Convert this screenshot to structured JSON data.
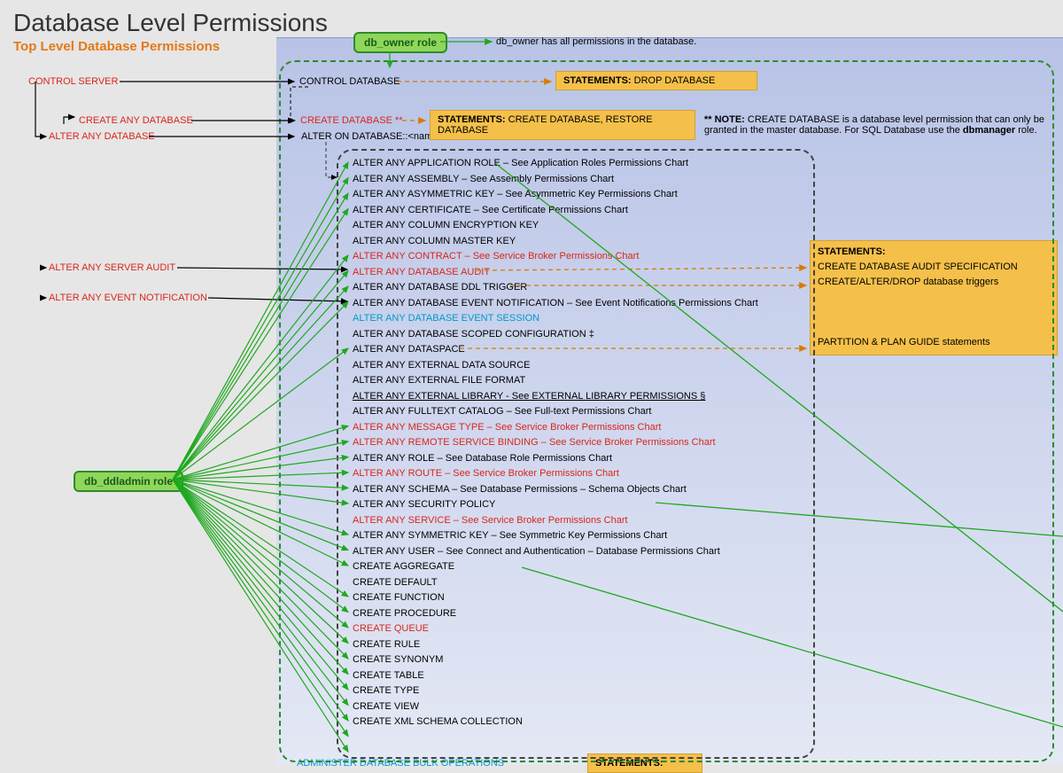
{
  "title": "Database Level Permissions",
  "subtitle": "Top Level Database Permissions",
  "roles": {
    "db_owner": "db_owner role",
    "db_owner_note": "db_owner has all permissions in the database.",
    "db_ddladmin": "db_ddladmin role"
  },
  "left": {
    "control_server": "CONTROL SERVER",
    "create_any_db": "CREATE ANY DATABASE",
    "alter_any_db": "ALTER ANY DATABASE",
    "alter_server_audit": "ALTER ANY SERVER AUDIT",
    "alter_event_notif": "ALTER ANY EVENT NOTIFICATION"
  },
  "center": {
    "control_db": "CONTROL DATABASE",
    "create_db": "CREATE DATABASE **",
    "alter_on_db": "ALTER ON DATABASE::<name>",
    "admin_bulk": "ADMINISTER DATABASE BULK OPERATIONS"
  },
  "stmt": {
    "drop_db_label": "STATEMENTS:",
    "drop_db": " DROP DATABASE",
    "create_db_label": "STATEMENTS:",
    "create_db": " CREATE DATABASE, RESTORE DATABASE",
    "right_label": "STATEMENTS:",
    "right_l1": "CREATE DATABASE AUDIT SPECIFICATION",
    "right_l2": "CREATE/ALTER/DROP database triggers",
    "right_l3": "PARTITION & PLAN GUIDE statements",
    "bottom_label": "STATEMENTS:"
  },
  "note": {
    "prefix": "** NOTE: ",
    "body1": "CREATE DATABASE is a database level permission that can only be",
    "body2": "granted in the master database. For SQL Database use the ",
    "body3": "dbmanager",
    "body4": " role."
  },
  "perms": [
    {
      "t": "ALTER ANY APPLICATION ROLE – See Application Roles Permissions Chart",
      "c": "black",
      "arrow": true
    },
    {
      "t": "ALTER ANY ASSEMBLY – See Assembly Permissions Chart",
      "c": "black",
      "arrow": true
    },
    {
      "t": "ALTER ANY ASYMMETRIC KEY – See Asymmetric Key Permissions Chart",
      "c": "black",
      "arrow": true
    },
    {
      "t": "ALTER ANY CERTIFICATE – See Certificate Permissions Chart",
      "c": "black",
      "arrow": true
    },
    {
      "t": "ALTER ANY COLUMN ENCRYPTION KEY",
      "c": "black",
      "arrow": false
    },
    {
      "t": "ALTER ANY COLUMN MASTER KEY",
      "c": "black",
      "arrow": false
    },
    {
      "t": "ALTER ANY CONTRACT – See Service Broker Permissions Chart",
      "c": "red",
      "arrow": true
    },
    {
      "t": "ALTER ANY DATABASE AUDIT",
      "c": "red",
      "arrow": true
    },
    {
      "t": "ALTER ANY DATABASE DDL TRIGGER",
      "c": "black",
      "arrow": true
    },
    {
      "t": "ALTER ANY DATABASE EVENT NOTIFICATION – See Event Notifications Permissions Chart",
      "c": "black",
      "arrow": true
    },
    {
      "t": "ALTER ANY DATABASE EVENT SESSION",
      "c": "blue",
      "arrow": false
    },
    {
      "t": "ALTER ANY DATABASE SCOPED CONFIGURATION ‡",
      "c": "black",
      "arrow": false
    },
    {
      "t": "ALTER ANY DATASPACE",
      "c": "black",
      "arrow": true
    },
    {
      "t": "ALTER ANY EXTERNAL DATA SOURCE",
      "c": "black",
      "arrow": false
    },
    {
      "t": "ALTER ANY EXTERNAL FILE FORMAT",
      "c": "black",
      "arrow": false
    },
    {
      "t": "ALTER ANY EXTERNAL LIBRARY - See EXTERNAL LIBRARY PERMISSIONS §",
      "c": "black",
      "arrow": false,
      "u": true
    },
    {
      "t": " ",
      "c": "black",
      "arrow": false
    },
    {
      "t": "ALTER ANY FULLTEXT CATALOG – See Full-text Permissions Chart",
      "c": "black",
      "arrow": true
    },
    {
      "t": "ALTER ANY MESSAGE TYPE – See Service Broker Permissions Chart",
      "c": "red",
      "arrow": true
    },
    {
      "t": "ALTER ANY REMOTE SERVICE BINDING – See Service Broker Permissions Chart",
      "c": "red",
      "arrow": true
    },
    {
      "t": "ALTER ANY ROLE – See Database Role Permissions Chart",
      "c": "black",
      "arrow": true
    },
    {
      "t": "ALTER ANY ROUTE – See Service Broker Permissions Chart",
      "c": "red",
      "arrow": true
    },
    {
      "t": "ALTER ANY SCHEMA – See Database Permissions – Schema Objects Chart",
      "c": "black",
      "arrow": true
    },
    {
      "t": "ALTER ANY SECURITY POLICY",
      "c": "black",
      "arrow": false
    },
    {
      "t": "ALTER ANY SERVICE – See Service Broker Permissions Chart",
      "c": "red",
      "arrow": true
    },
    {
      "t": "ALTER ANY SYMMETRIC KEY – See Symmetric Key Permissions Chart",
      "c": "black",
      "arrow": true
    },
    {
      "t": "ALTER ANY USER – See Connect and Authentication – Database Permissions Chart",
      "c": "black",
      "arrow": true
    },
    {
      "t": " ",
      "c": "black",
      "arrow": false
    },
    {
      "t": "CREATE AGGREGATE",
      "c": "black",
      "arrow": true
    },
    {
      "t": "CREATE DEFAULT",
      "c": "black",
      "arrow": true
    },
    {
      "t": "CREATE FUNCTION",
      "c": "black",
      "arrow": true
    },
    {
      "t": "CREATE PROCEDURE",
      "c": "black",
      "arrow": true
    },
    {
      "t": "CREATE QUEUE",
      "c": "red",
      "arrow": true
    },
    {
      "t": "CREATE RULE",
      "c": "black",
      "arrow": true
    },
    {
      "t": "CREATE SYNONYM",
      "c": "black",
      "arrow": true
    },
    {
      "t": "CREATE TABLE",
      "c": "black",
      "arrow": true
    },
    {
      "t": "CREATE TYPE",
      "c": "black",
      "arrow": true
    },
    {
      "t": "CREATE VIEW",
      "c": "black",
      "arrow": true
    },
    {
      "t": "CREATE XML SCHEMA COLLECTION",
      "c": "black",
      "arrow": true
    }
  ]
}
